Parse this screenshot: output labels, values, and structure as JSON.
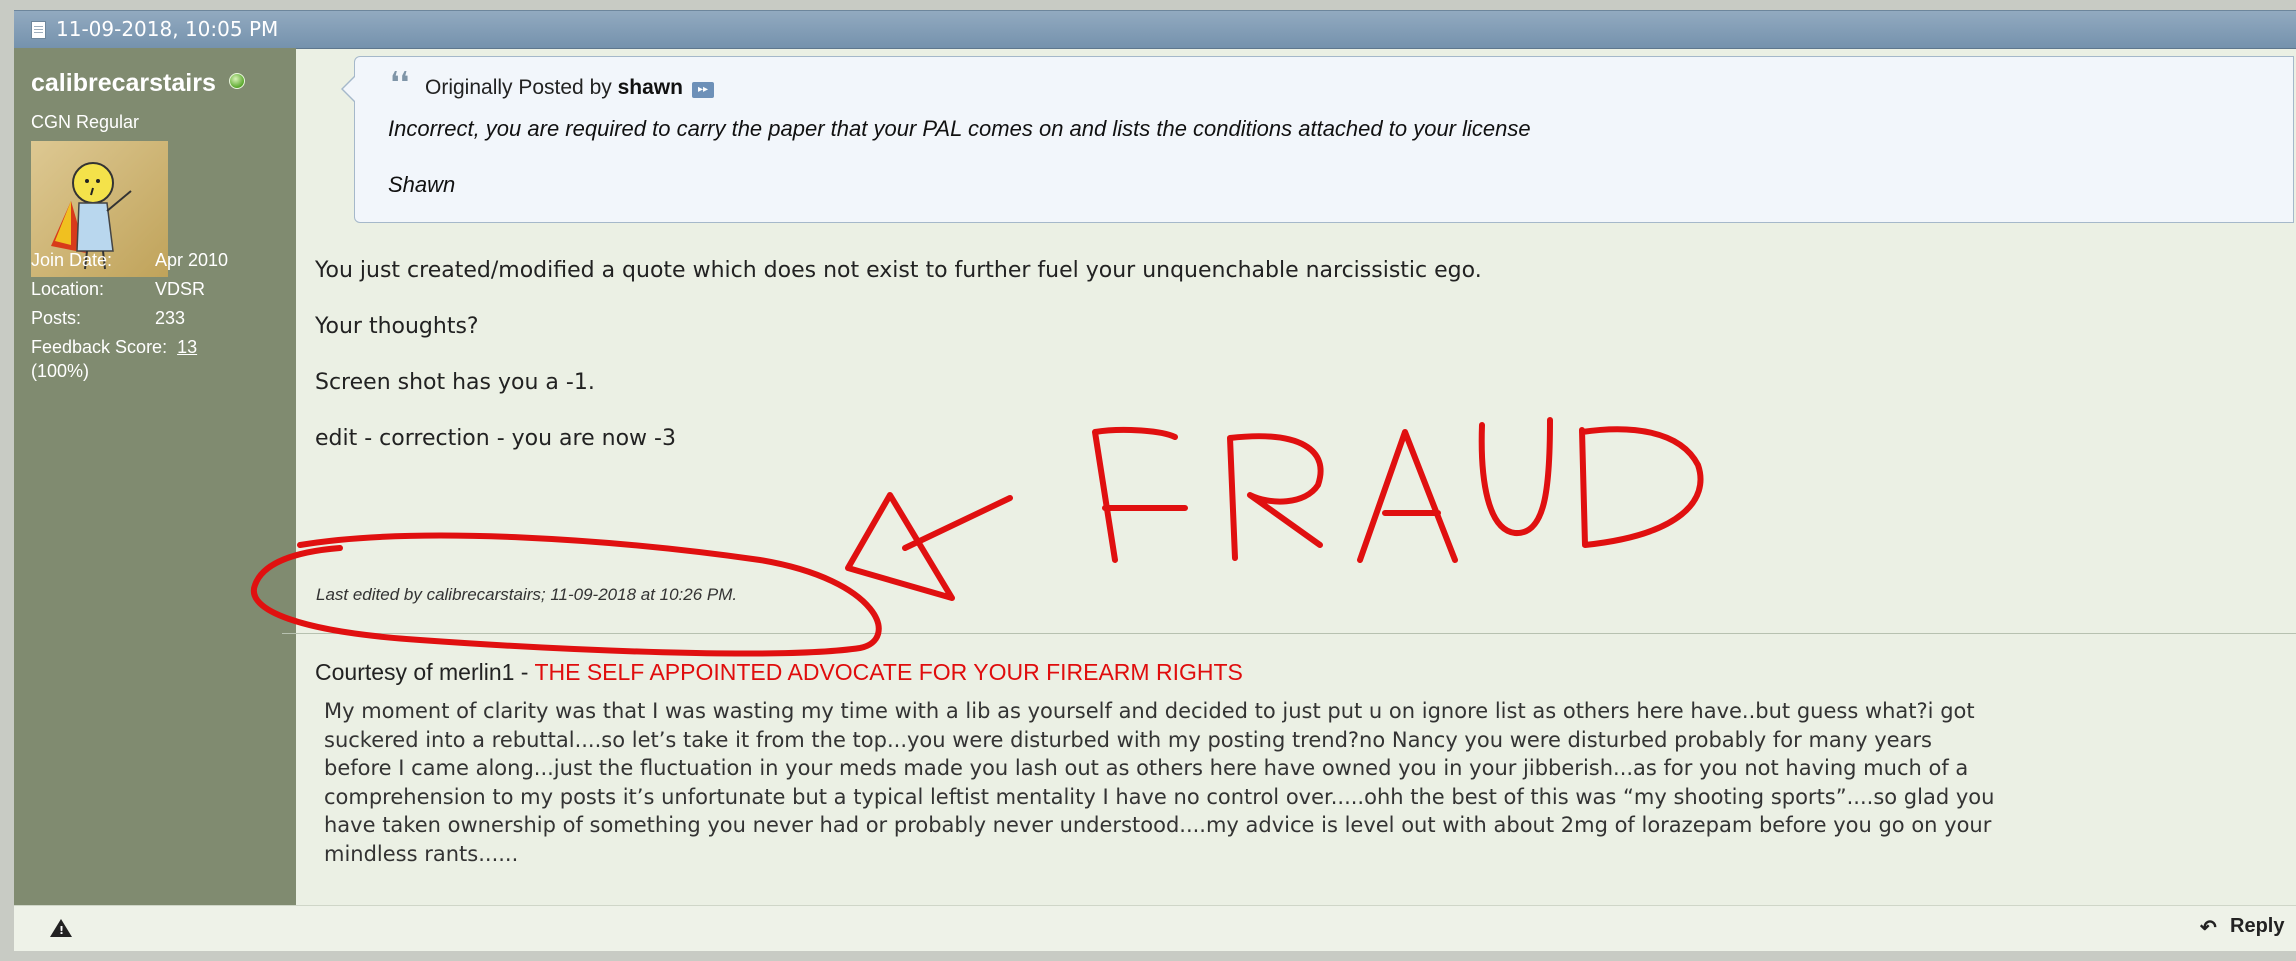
{
  "post": {
    "date": "11-09-2018, 10:05 PM",
    "author": {
      "username": "calibrecarstairs",
      "title": "CGN Regular",
      "join_label": "Join Date:",
      "join_value": "Apr 2010",
      "location_label": "Location:",
      "location_value": "VDSR",
      "posts_label": "Posts:",
      "posts_value": "233",
      "feedback_label": "Feedback Score:",
      "feedback_value": "13",
      "feedback_percent": "(100%)"
    },
    "quote": {
      "prefix": "Originally Posted by",
      "poster": "shawn",
      "line1": "Incorrect, you are required to carry the paper that your PAL comes on and lists the conditions attached to your license",
      "line2": "Shawn"
    },
    "body": [
      "You just created/modified a quote which does not exist to further fuel your unquenchable narcissistic ego.",
      "Your thoughts?",
      "Screen shot has you a -1.",
      "edit - correction - you are now -3"
    ],
    "edited_note": "Last edited by calibrecarstairs; 11-09-2018 at 10:26 PM.",
    "signature": {
      "lead": "Courtesy of merlin1 - ",
      "highlight": "THE SELF APPOINTED ADVOCATE FOR YOUR FIREARM RIGHTS",
      "lines": [
        "My moment of clarity was that I was wasting my time with a lib as yourself and decided to just put u on ignore list as others here have..but guess what?i got",
        "suckered into a rebuttal....so let’s take it from the top...you were disturbed with my posting trend?no Nancy you were disturbed probably for many years",
        "before I came along...just the fluctuation in your meds made you lash out as others here have owned you in your jibberish...as for you not having much of a",
        "comprehension to my posts it’s unfortunate but a typical leftist mentality I have no control over.....ohh the best of this was “my shooting sports”....so glad you",
        "have taken ownership of something you never had or probably never understood....my advice is level out with about 2mg of lorazepam before you go on your",
        "mindless rants......"
      ]
    },
    "footer": {
      "reply_label": "Reply"
    }
  },
  "annotation": {
    "color": "#e01010"
  }
}
